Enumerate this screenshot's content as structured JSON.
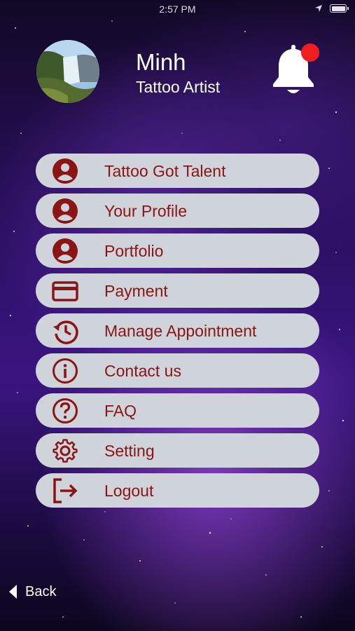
{
  "status_bar": {
    "time": "2:57 PM"
  },
  "profile": {
    "name": "Minh",
    "role": "Tattoo Artist"
  },
  "colors": {
    "accent": "#8b1414",
    "pill": "#cfd4db",
    "badge": "#f01e1e"
  },
  "menu": [
    {
      "label": "Tattoo Got Talent",
      "icon": "person-circle-icon"
    },
    {
      "label": "Your Profile",
      "icon": "person-circle-icon"
    },
    {
      "label": "Portfolio",
      "icon": "person-circle-icon"
    },
    {
      "label": "Payment",
      "icon": "credit-card-icon"
    },
    {
      "label": "Manage Appointment",
      "icon": "history-icon"
    },
    {
      "label": "Contact us",
      "icon": "info-icon"
    },
    {
      "label": "FAQ",
      "icon": "question-icon"
    },
    {
      "label": "Setting",
      "icon": "gear-icon"
    },
    {
      "label": "Logout",
      "icon": "logout-icon"
    }
  ],
  "back_label": "Back"
}
